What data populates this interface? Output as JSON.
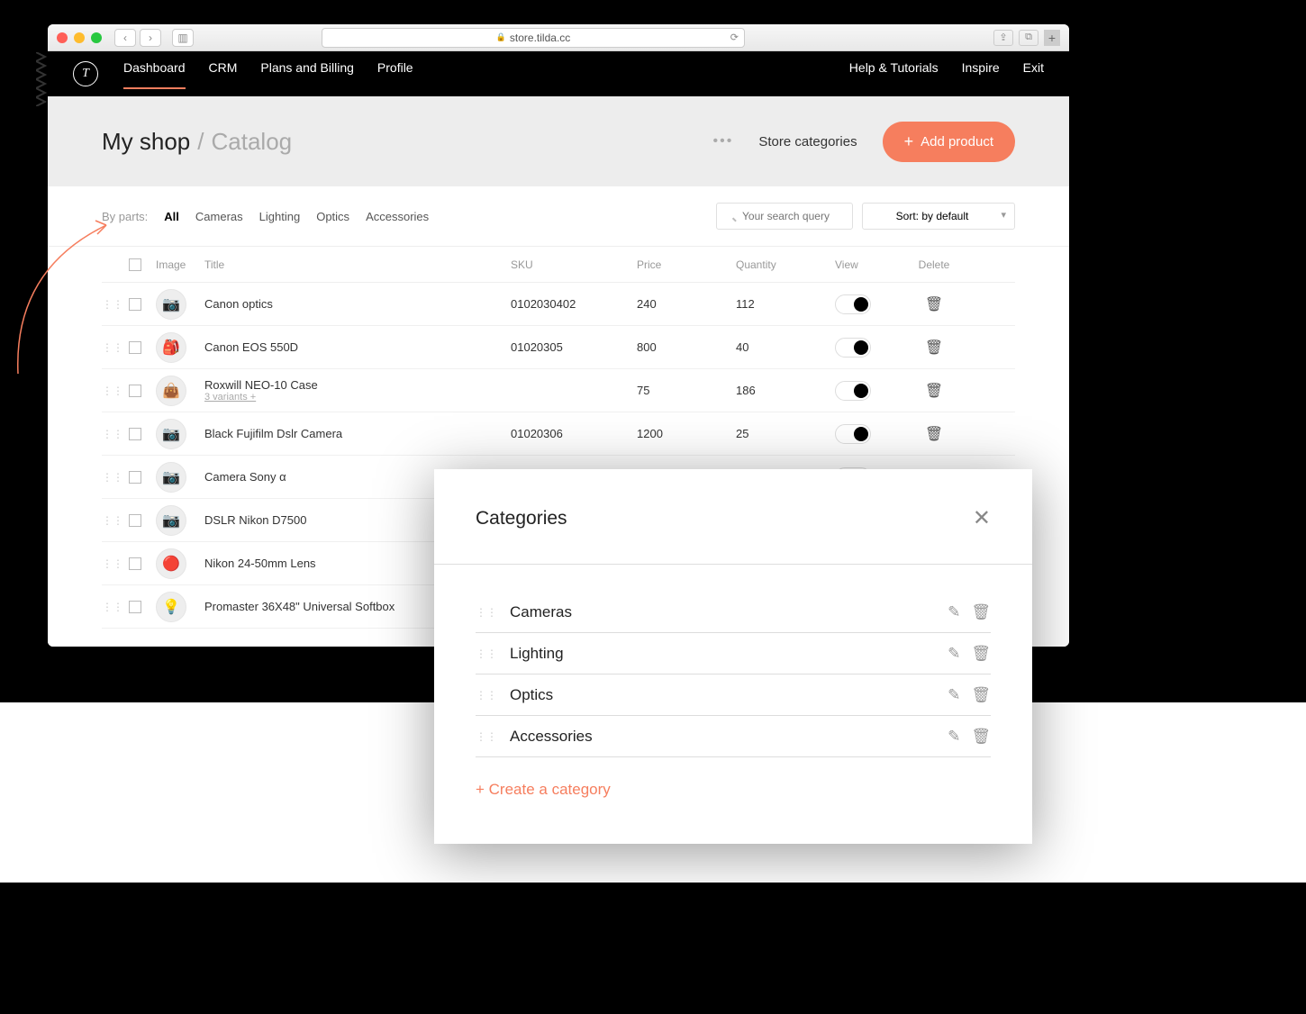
{
  "browser": {
    "url": "store.tilda.cc"
  },
  "nav": {
    "items": [
      "Dashboard",
      "CRM",
      "Plans and Billing",
      "Profile"
    ],
    "right": [
      "Help & Tutorials",
      "Inspire",
      "Exit"
    ],
    "active_index": 0
  },
  "breadcrumb": {
    "root": "My shop",
    "current": "Catalog"
  },
  "subheader": {
    "store_categories": "Store categories",
    "add_product": "Add product"
  },
  "filters": {
    "label": "By parts:",
    "items": [
      "All",
      "Cameras",
      "Lighting",
      "Optics",
      "Accessories"
    ],
    "active_index": 0,
    "search_placeholder": "Your search query",
    "sort_label": "Sort: by default"
  },
  "columns": {
    "image": "Image",
    "title": "Title",
    "sku": "SKU",
    "price": "Price",
    "quantity": "Quantity",
    "view": "View",
    "delete": "Delete"
  },
  "products": [
    {
      "icon": "📷",
      "title": "Canon optics",
      "sku": "0102030402",
      "price": "240",
      "qty": "112"
    },
    {
      "icon": "🎒",
      "title": "Canon EOS 550D",
      "sku": "01020305",
      "price": "800",
      "qty": "40"
    },
    {
      "icon": "👜",
      "title": "Roxwill NEO-10 Case",
      "variants": "3 variants +",
      "sku": "",
      "price": "75",
      "qty": "186"
    },
    {
      "icon": "📷",
      "title": "Black Fujifilm Dslr Camera",
      "sku": "01020306",
      "price": "1200",
      "qty": "25"
    },
    {
      "icon": "📷",
      "title": "Camera Sony α",
      "sku": "",
      "price": "",
      "qty": ""
    },
    {
      "icon": "📷",
      "title": "DSLR Nikon D7500",
      "sku": "",
      "price": "",
      "qty": ""
    },
    {
      "icon": "🔴",
      "title": "Nikon 24-50mm Lens",
      "sku": "",
      "price": "",
      "qty": ""
    },
    {
      "icon": "💡",
      "title": "Promaster 36X48\" Universal Softbox",
      "sku": "",
      "price": "",
      "qty": ""
    }
  ],
  "popup": {
    "title": "Categories",
    "categories": [
      "Cameras",
      "Lighting",
      "Optics",
      "Accessories"
    ],
    "create": "+ Create a category"
  }
}
